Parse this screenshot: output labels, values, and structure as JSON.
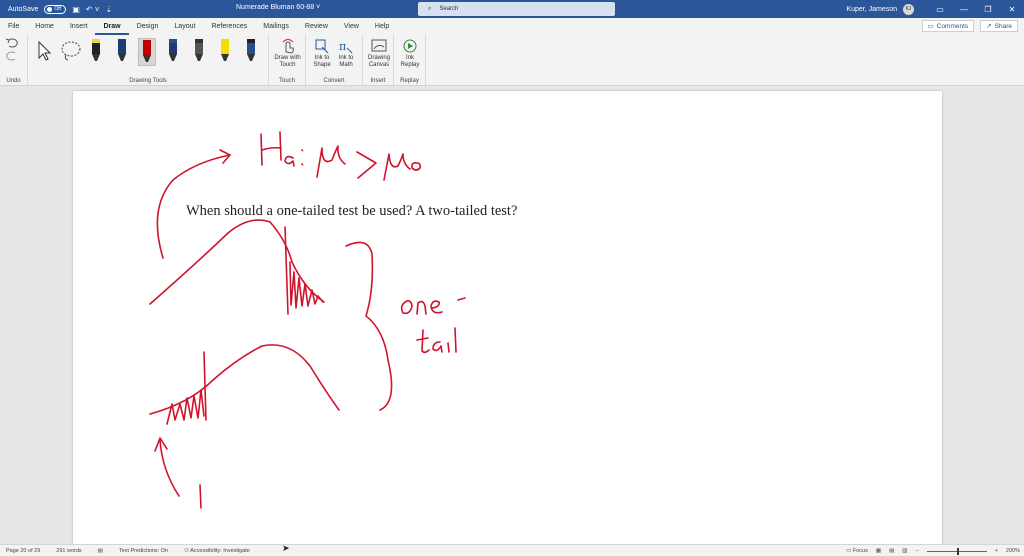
{
  "titlebar": {
    "autosave_label": "AutoSave",
    "autosave_state": "Off",
    "doc_title": "Numerade Bluman 60-88",
    "search_placeholder": "Search",
    "user_name": "Kuper, Jameson",
    "user_initials": "KJ"
  },
  "tabs": [
    "File",
    "Home",
    "Insert",
    "Draw",
    "Design",
    "Layout",
    "References",
    "Mailings",
    "Review",
    "View",
    "Help"
  ],
  "active_tab": "Draw",
  "tab_actions": {
    "comments": "Comments",
    "share": "Share"
  },
  "ribbon": {
    "undo_group": "Undo",
    "drawing_tools_group": "Drawing Tools",
    "touch_group": "Touch",
    "convert_group": "Convert",
    "insert_group": "Insert",
    "replay_group": "Replay",
    "draw_with_touch_line1": "Draw with",
    "draw_with_touch_line2": "Touch",
    "ink_to_shape_line1": "Ink to",
    "ink_to_shape_line2": "Shape",
    "ink_to_math_line1": "Ink to",
    "ink_to_math_line2": "Math",
    "drawing_canvas_line1": "Drawing",
    "drawing_canvas_line2": "Canvas",
    "ink_replay_line1": "Ink",
    "ink_replay_line2": "Replay"
  },
  "pens": [
    {
      "color": "#222222",
      "tip": "#f2d14b"
    },
    {
      "color": "#1f3b73",
      "tip": "#1f3b73"
    },
    {
      "color": "#c00000",
      "tip": "#c00000"
    },
    {
      "color": "#1f3b73",
      "tip": "#2a4d8f"
    },
    {
      "color": "#555555",
      "tip": "#333333"
    },
    {
      "color": "#f0e000",
      "tip": "#f0e000"
    },
    {
      "color": "#2a4d8f",
      "tip": "#222222"
    }
  ],
  "document": {
    "question": "When should a one-tailed test be used? A two-tailed test?",
    "ink_color": "#d0142c"
  },
  "statusbar": {
    "page": "Page 20 of 29",
    "words": "291 words",
    "text_predictions": "Text Predictions: On",
    "accessibility": "Accessibility: Investigate",
    "focus": "Focus",
    "zoom": "200%"
  },
  "colors": {
    "accent": "#2b579a",
    "ribbon_bg": "#f3f3f3",
    "canvas_bg": "#e6e6e6"
  }
}
